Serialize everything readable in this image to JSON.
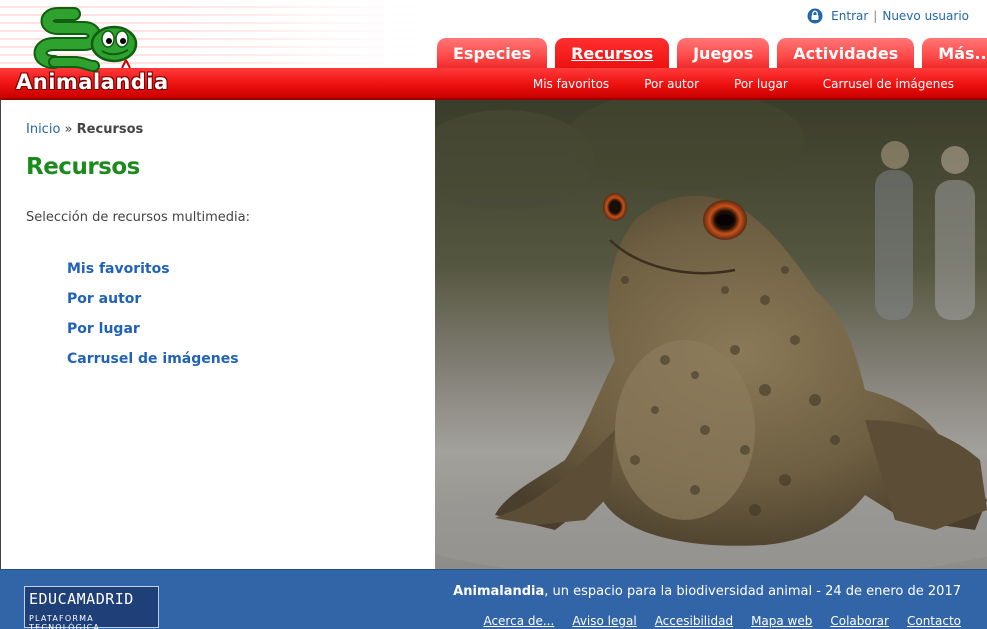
{
  "brand": {
    "name": "Animalandia",
    "colors": {
      "red": "#ee1111",
      "green_title": "#1d8a1d",
      "link_blue": "#1f62b8",
      "footer_blue": "#3264a8"
    }
  },
  "top_links": {
    "icon": "lock-icon",
    "login": "Entrar",
    "separator": "|",
    "register": "Nuevo usuario"
  },
  "tabs": [
    {
      "label": "Especies",
      "active": false
    },
    {
      "label": "Recursos",
      "active": true
    },
    {
      "label": "Juegos",
      "active": false
    },
    {
      "label": "Actividades",
      "active": false
    },
    {
      "label": "Más...",
      "active": false
    }
  ],
  "subnav": [
    "Mis favoritos",
    "Por autor",
    "Por lugar",
    "Carrusel de imágenes"
  ],
  "breadcrumb": {
    "home": "Inicio",
    "sep": "»",
    "current": "Recursos"
  },
  "main": {
    "title": "Recursos",
    "intro": "Selección de recursos multimedia:",
    "links": [
      "Mis favoritos",
      "Por autor",
      "Por lugar",
      "Carrusel de imágenes"
    ]
  },
  "footer": {
    "logo_top": "EDUCAMADRID",
    "logo_bottom": "PLATAFORMA TECNOLÓGICA",
    "site": "Animalandia",
    "tagline": ", un espacio para la biodiversidad animal - 24 de enero de 2017",
    "links": [
      "Acerca de...",
      "Aviso legal",
      "Accesibilidad",
      "Mapa web",
      "Colaborar",
      "Contacto"
    ]
  }
}
